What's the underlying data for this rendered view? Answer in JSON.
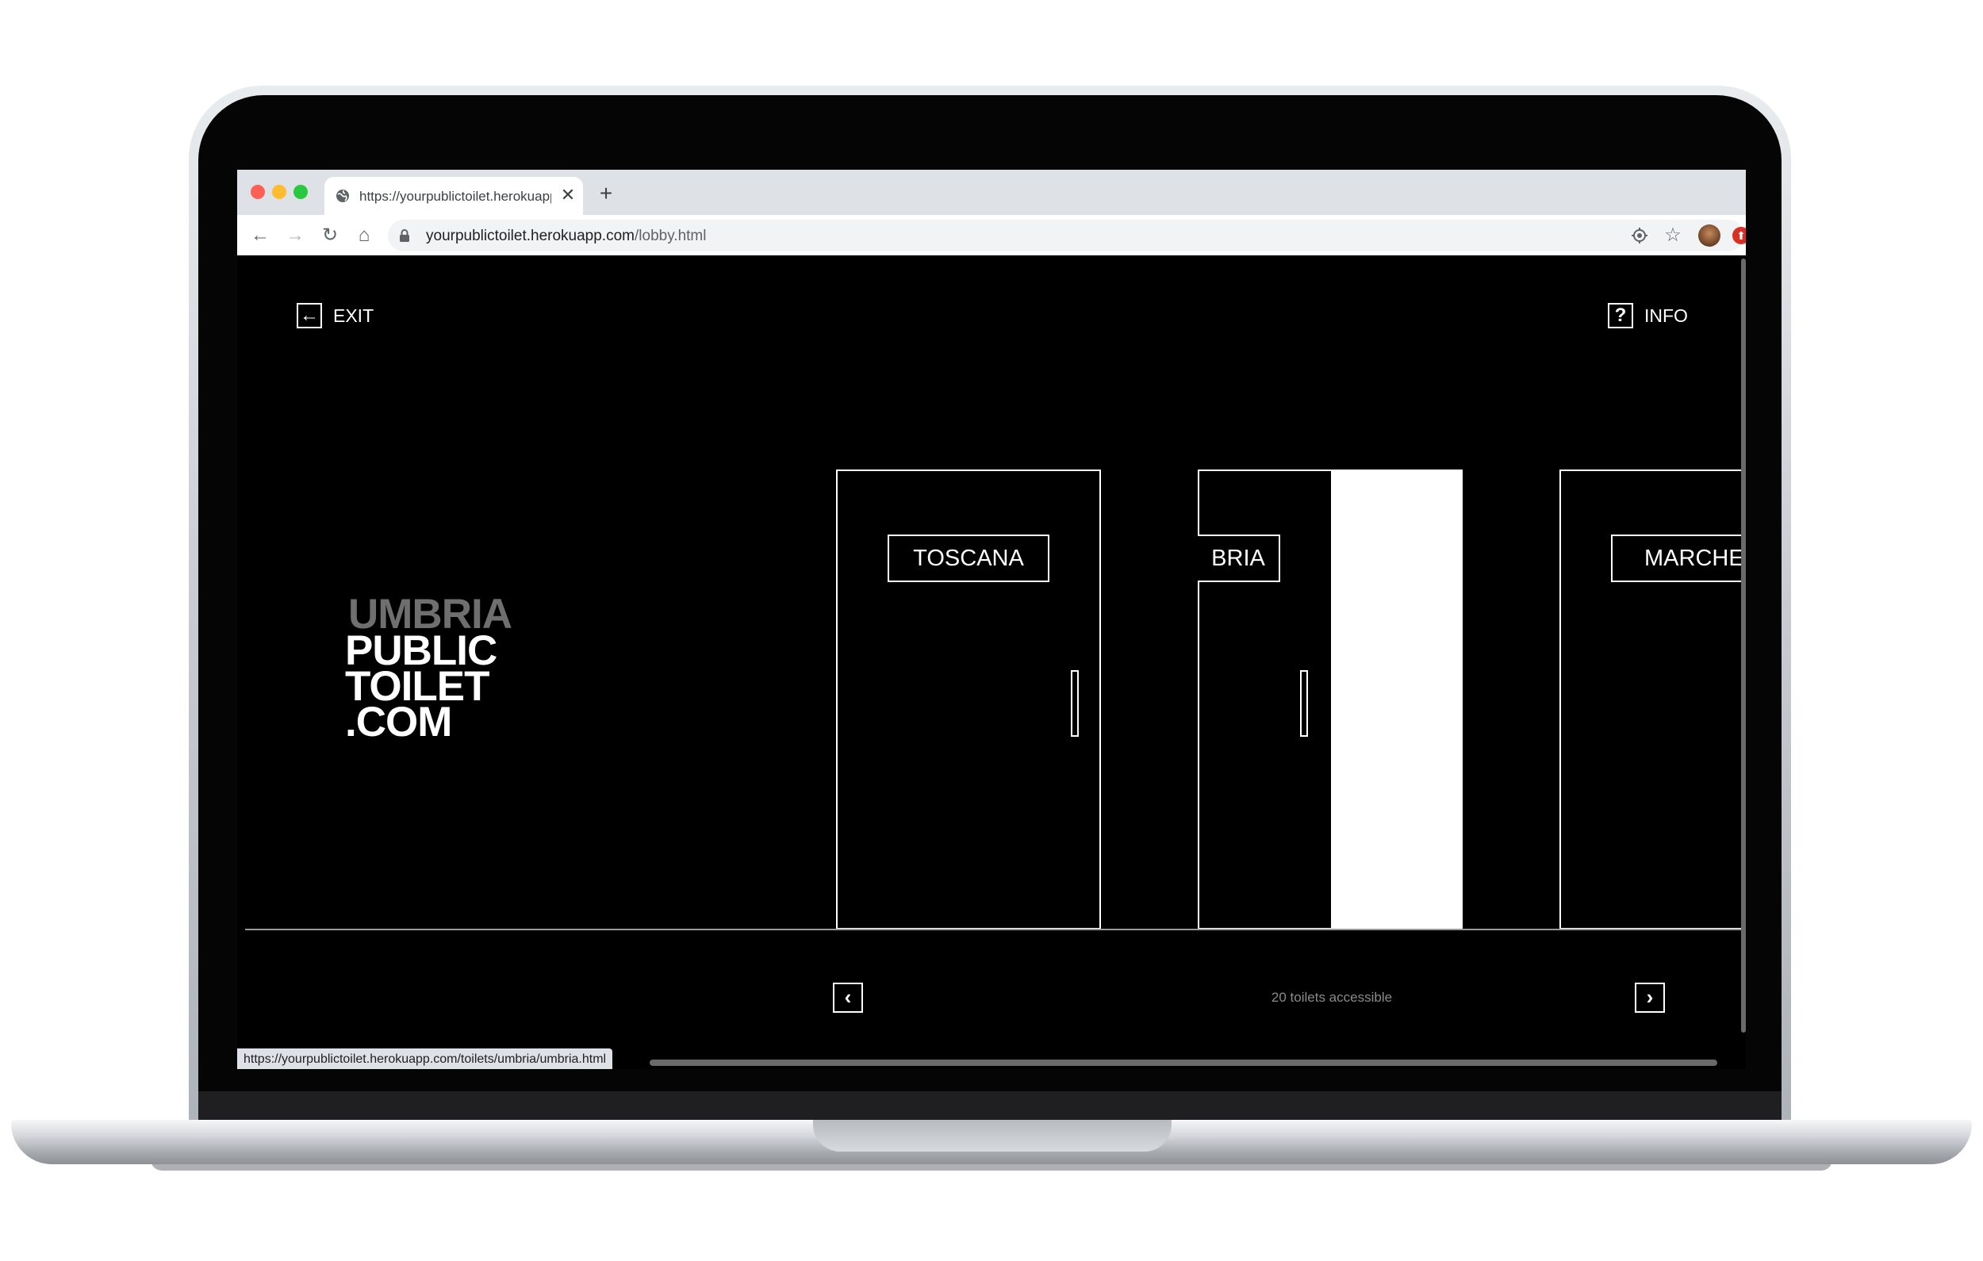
{
  "browser": {
    "tab_title": "https://yourpublictoilet.herokuapp.com/lobby.html",
    "tab_close": "✕",
    "new_tab": "+",
    "url_host": "yourpublictoilet.herokuapp.com",
    "url_path": "/lobby.html",
    "status_url": "https://yourpublictoilet.herokuapp.com/toilets/umbria/umbria.html",
    "icons": {
      "favicon": "globe-icon",
      "back": "←",
      "forward": "→",
      "reload": "↻",
      "home": "⌂",
      "star": "☆",
      "update": "⬆"
    }
  },
  "page": {
    "exit_label": "EXIT",
    "exit_icon": "←",
    "info_label": "INFO",
    "info_icon": "?",
    "logo": {
      "line1": "UMBRIA",
      "line2": "PUBLIC",
      "line3": "TOILET",
      "line4": ".COM"
    },
    "doors": [
      {
        "label": "TOSCANA"
      },
      {
        "label": "BRIA"
      },
      {
        "label": "MARCHE"
      }
    ],
    "prev_icon": "‹",
    "next_icon": "›",
    "accessible_text": "20 toilets accessible"
  },
  "colors": {
    "page_background": "#000000",
    "foreground": "#ffffff",
    "logo_region": "#6f6f6f"
  }
}
